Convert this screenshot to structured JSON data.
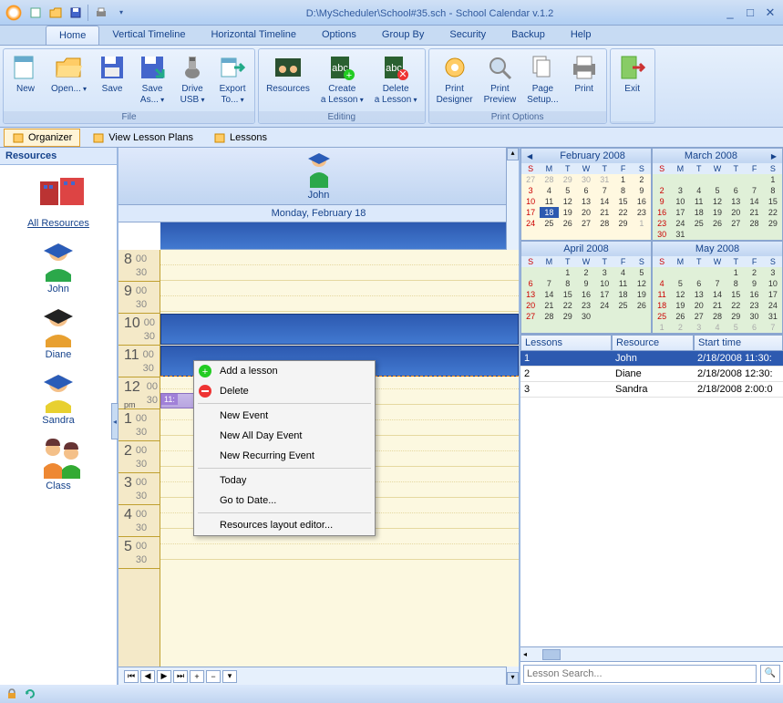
{
  "titlebar": {
    "path": "D:\\MyScheduler\\School#35.sch",
    "app": "School Calendar v.1.2"
  },
  "menutabs": [
    "Home",
    "Vertical Timeline",
    "Horizontal Timeline",
    "Options",
    "Group By",
    "Security",
    "Backup",
    "Help"
  ],
  "active_menutab": 0,
  "ribbon": {
    "groups": [
      {
        "title": "File",
        "items": [
          {
            "label": "New",
            "icon": "new"
          },
          {
            "label": "Open...",
            "icon": "open",
            "dropdown": true
          },
          {
            "label": "Save",
            "icon": "save"
          },
          {
            "label": "Save As...",
            "icon": "saveas",
            "dropdown": true
          },
          {
            "label": "Drive USB",
            "icon": "usb",
            "dropdown": true
          },
          {
            "label": "Export To...",
            "icon": "export",
            "dropdown": true
          }
        ]
      },
      {
        "title": "Editing",
        "items": [
          {
            "label": "Resources",
            "icon": "resources"
          },
          {
            "label": "Create a Lesson",
            "icon": "createlesson",
            "dropdown": true
          },
          {
            "label": "Delete a Lesson",
            "icon": "deletelesson",
            "dropdown": true
          }
        ]
      },
      {
        "title": "Print Options",
        "items": [
          {
            "label": "Print Designer",
            "icon": "printdes"
          },
          {
            "label": "Print Preview",
            "icon": "preview"
          },
          {
            "label": "Page Setup...",
            "icon": "pagesetup"
          },
          {
            "label": "Print",
            "icon": "print"
          }
        ]
      },
      {
        "title": "",
        "items": [
          {
            "label": "Exit",
            "icon": "exit"
          }
        ]
      }
    ]
  },
  "subtabs": [
    {
      "label": "Organizer",
      "active": true
    },
    {
      "label": "View Lesson Plans",
      "active": false
    },
    {
      "label": "Lessons",
      "active": false
    }
  ],
  "sidebar": {
    "title": "Resources",
    "items": [
      {
        "label": "All Resources",
        "type": "all"
      },
      {
        "label": "John",
        "type": "person"
      },
      {
        "label": "Diane",
        "type": "person"
      },
      {
        "label": "Sandra",
        "type": "person"
      },
      {
        "label": "Class",
        "type": "class"
      }
    ]
  },
  "calendar": {
    "resource_name": "John",
    "date_label": "Monday, February 18",
    "hours": [
      "8",
      "9",
      "10",
      "11",
      "12",
      "1",
      "2",
      "3",
      "4",
      "5"
    ],
    "ampm": [
      "",
      "",
      "",
      "",
      "pm",
      "",
      "",
      "",
      "",
      ""
    ],
    "event_time": "11:"
  },
  "context_menu": [
    {
      "label": "Add a lesson",
      "icon": "add"
    },
    {
      "label": "Delete",
      "icon": "del"
    },
    {
      "sep": true
    },
    {
      "label": "New Event"
    },
    {
      "label": "New All Day Event"
    },
    {
      "label": "New Recurring Event"
    },
    {
      "sep": true
    },
    {
      "label": "Today"
    },
    {
      "label": "Go to Date..."
    },
    {
      "sep": true
    },
    {
      "label": "Resources layout editor..."
    }
  ],
  "minicals": [
    {
      "title": "February 2008",
      "active": true,
      "nav": "left",
      "days": [
        [
          27,
          28,
          29,
          30,
          31,
          1,
          2
        ],
        [
          3,
          4,
          5,
          6,
          7,
          8,
          9
        ],
        [
          10,
          11,
          12,
          13,
          14,
          15,
          16
        ],
        [
          17,
          18,
          19,
          20,
          21,
          22,
          23
        ],
        [
          24,
          25,
          26,
          27,
          28,
          29,
          1
        ]
      ],
      "other_before": 5,
      "other_after": 1,
      "today": 18
    },
    {
      "title": "March 2008",
      "active": false,
      "nav": "right",
      "days": [
        [
          null,
          null,
          null,
          null,
          null,
          null,
          1
        ],
        [
          2,
          3,
          4,
          5,
          6,
          7,
          8
        ],
        [
          9,
          10,
          11,
          12,
          13,
          14,
          15
        ],
        [
          16,
          17,
          18,
          19,
          20,
          21,
          22
        ],
        [
          23,
          24,
          25,
          26,
          27,
          28,
          29
        ],
        [
          30,
          31,
          null,
          null,
          null,
          null,
          null
        ]
      ],
      "other_before": 0,
      "other_after": 0
    },
    {
      "title": "April 2008",
      "active": false,
      "days": [
        [
          null,
          null,
          1,
          2,
          3,
          4,
          5
        ],
        [
          6,
          7,
          8,
          9,
          10,
          11,
          12
        ],
        [
          13,
          14,
          15,
          16,
          17,
          18,
          19
        ],
        [
          20,
          21,
          22,
          23,
          24,
          25,
          26
        ],
        [
          27,
          28,
          29,
          30,
          null,
          null,
          null
        ]
      ],
      "other_before": 0,
      "other_after": 0
    },
    {
      "title": "May 2008",
      "active": false,
      "days": [
        [
          null,
          null,
          null,
          null,
          1,
          2,
          3
        ],
        [
          4,
          5,
          6,
          7,
          8,
          9,
          10
        ],
        [
          11,
          12,
          13,
          14,
          15,
          16,
          17
        ],
        [
          18,
          19,
          20,
          21,
          22,
          23,
          24
        ],
        [
          25,
          26,
          27,
          28,
          29,
          30,
          31
        ],
        [
          1,
          2,
          3,
          4,
          5,
          6,
          7
        ]
      ],
      "other_before": 0,
      "other_after": 7
    }
  ],
  "dow": [
    "S",
    "M",
    "T",
    "W",
    "T",
    "F",
    "S"
  ],
  "lessons": {
    "headers": [
      "Lessons",
      "Resource",
      "Start time"
    ],
    "rows": [
      {
        "n": "1",
        "res": "John",
        "time": "2/18/2008 11:30:",
        "selected": true
      },
      {
        "n": "2",
        "res": "Diane",
        "time": "2/18/2008 12:30:"
      },
      {
        "n": "3",
        "res": "Sandra",
        "time": "2/18/2008 2:00:0"
      }
    ]
  },
  "search": {
    "placeholder": "Lesson Search..."
  }
}
